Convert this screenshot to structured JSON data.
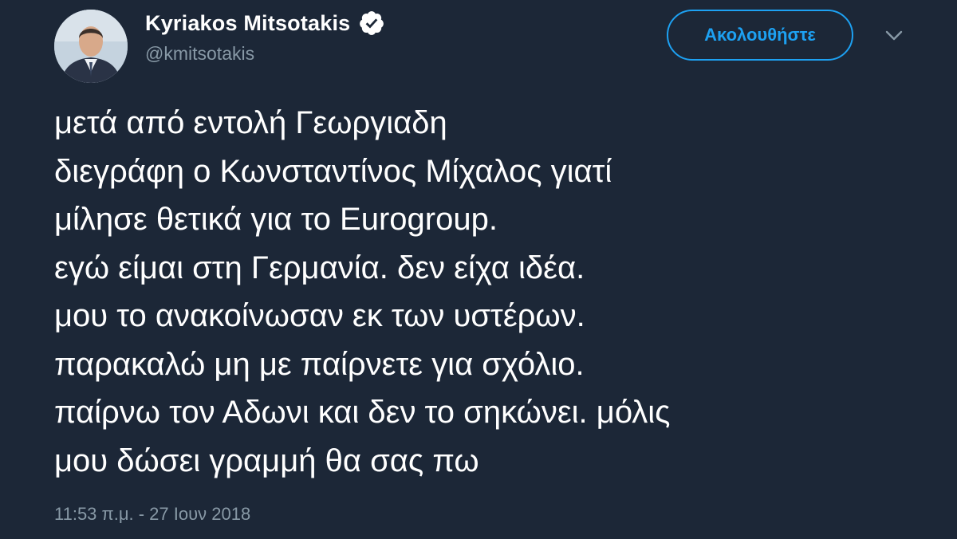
{
  "author": {
    "display_name": "Kyriakos Mitsotakis",
    "handle": "@kmitsotakis",
    "verified": true
  },
  "follow_button": {
    "label": "Ακολουθήστε"
  },
  "tweet": {
    "lines": [
      "μετά από εντολή Γεωργιαδη",
      "διεγράφη ο Κωνσταντίνος Μίχαλος γιατί",
      "μίλησε θετικά για το Eurogroup.",
      "εγώ είμαι στη Γερμανία. δεν είχα ιδέα.",
      "μου το ανακοίνωσαν εκ των υστέρων.",
      "παρακαλώ μη με παίρνετε για σχόλιο.",
      "παίρνω τον Αδωνι και δεν το σηκώνει. μόλις",
      "μου δώσει γραμμή θα σας πω"
    ],
    "timestamp": "11:53 π.μ. - 27 Ιουν 2018"
  },
  "icons": {
    "verified": "verified-badge-icon",
    "caret": "chevron-down-icon"
  },
  "colors": {
    "background": "#1c2737",
    "text": "#ffffff",
    "secondary_text": "#8899a6",
    "accent": "#1da1f2"
  }
}
